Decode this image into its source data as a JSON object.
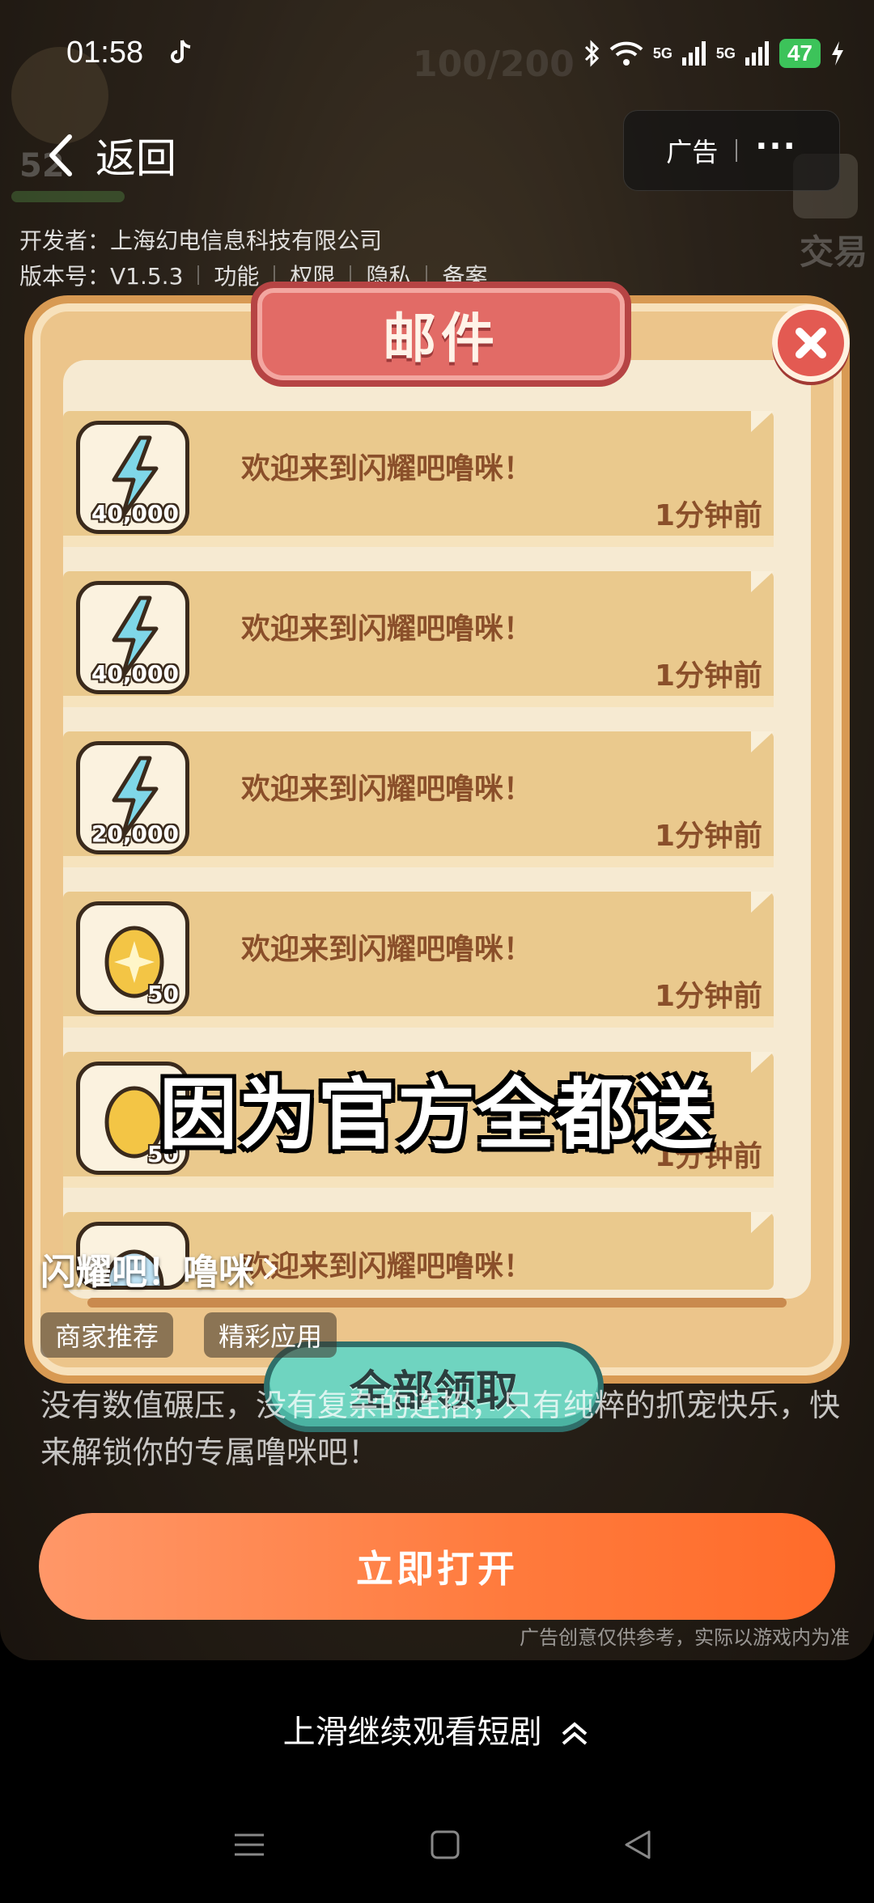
{
  "status_bar": {
    "time": "01:58",
    "network_1": "5G",
    "network_2": "5G",
    "battery": "47"
  },
  "header": {
    "back_label": "返回",
    "ad_label": "广告"
  },
  "developer": {
    "text": "开发者：上海幻电信息科技有限公司",
    "version": "版本号：V1.5.3",
    "links": [
      "功能",
      "权限",
      "隐私",
      "备案"
    ]
  },
  "game_hud": {
    "energy": "100/200",
    "level": "52",
    "trade_label": "交易"
  },
  "mail_panel": {
    "title": "邮件",
    "items": [
      {
        "icon": "lightning-icon",
        "qty": "40,000",
        "title": "欢迎来到闪耀吧噜咪！",
        "time": "1分钟前"
      },
      {
        "icon": "lightning-icon",
        "qty": "40,000",
        "title": "欢迎来到闪耀吧噜咪！",
        "time": "1分钟前"
      },
      {
        "icon": "lightning-icon",
        "qty": "20,000",
        "title": "欢迎来到闪耀吧噜咪！",
        "time": "1分钟前"
      },
      {
        "icon": "egg-icon",
        "qty": "50",
        "title": "欢迎来到闪耀吧噜咪！",
        "time": "1分钟前"
      },
      {
        "icon": "egg-icon",
        "qty": "50",
        "title": "",
        "time": "1分钟前"
      },
      {
        "icon": "crystal-egg-icon",
        "qty": "",
        "title": "欢迎来到闪耀吧噜咪！",
        "time": ""
      }
    ],
    "claim_all_label": "全部领取"
  },
  "subtitle": "因为官方全都送",
  "ad_info": {
    "app_name": "闪耀吧！噜咪",
    "tags": [
      "商家推荐",
      "精彩应用"
    ],
    "description": "没有数值碾压，没有复杂的连招，只有纯粹的抓宠快乐，快来解锁你的专属噜咪吧！",
    "open_button": "立即打开",
    "disclaimer": "广告创意仅供参考，实际以游戏内为准"
  },
  "swipe_hint": "上滑继续观看短剧",
  "colors": {
    "panel": "#ecc58b",
    "title_tab": "#e26b66",
    "claim_button": "#6fd4c0",
    "open_button": "#ff7a3c",
    "mail_text": "#8a4f2a"
  }
}
